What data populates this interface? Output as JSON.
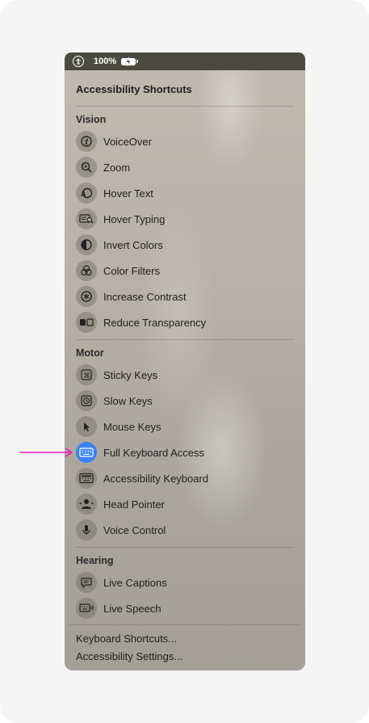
{
  "menubar": {
    "battery_percent": "100%"
  },
  "menu": {
    "title": "Accessibility Shortcuts",
    "vision": {
      "heading": "Vision",
      "items": [
        {
          "label": "VoiceOver",
          "icon": "voiceover-icon"
        },
        {
          "label": "Zoom",
          "icon": "zoom-icon"
        },
        {
          "label": "Hover Text",
          "icon": "hover-text-icon"
        },
        {
          "label": "Hover Typing",
          "icon": "hover-typing-icon"
        },
        {
          "label": "Invert Colors",
          "icon": "invert-colors-icon"
        },
        {
          "label": "Color Filters",
          "icon": "color-filters-icon"
        },
        {
          "label": "Increase Contrast",
          "icon": "increase-contrast-icon"
        },
        {
          "label": "Reduce Transparency",
          "icon": "reduce-transparency-icon"
        }
      ]
    },
    "motor": {
      "heading": "Motor",
      "items": [
        {
          "label": "Sticky Keys",
          "icon": "sticky-keys-icon"
        },
        {
          "label": "Slow Keys",
          "icon": "slow-keys-icon"
        },
        {
          "label": "Mouse Keys",
          "icon": "mouse-keys-icon"
        },
        {
          "label": "Full Keyboard Access",
          "icon": "keyboard-icon",
          "active": true
        },
        {
          "label": "Accessibility Keyboard",
          "icon": "accessibility-keyboard-icon"
        },
        {
          "label": "Head Pointer",
          "icon": "head-pointer-icon"
        },
        {
          "label": "Voice Control",
          "icon": "microphone-icon"
        }
      ]
    },
    "hearing": {
      "heading": "Hearing",
      "items": [
        {
          "label": "Live Captions",
          "icon": "live-captions-icon"
        },
        {
          "label": "Live Speech",
          "icon": "live-speech-icon"
        }
      ]
    },
    "footer": {
      "keyboard_shortcuts": "Keyboard Shortcuts...",
      "accessibility_settings": "Accessibility Settings..."
    }
  },
  "colors": {
    "active_icon": "#3b82f6",
    "arrow": "#e11fbf",
    "menubar": "#4a4a3e"
  }
}
